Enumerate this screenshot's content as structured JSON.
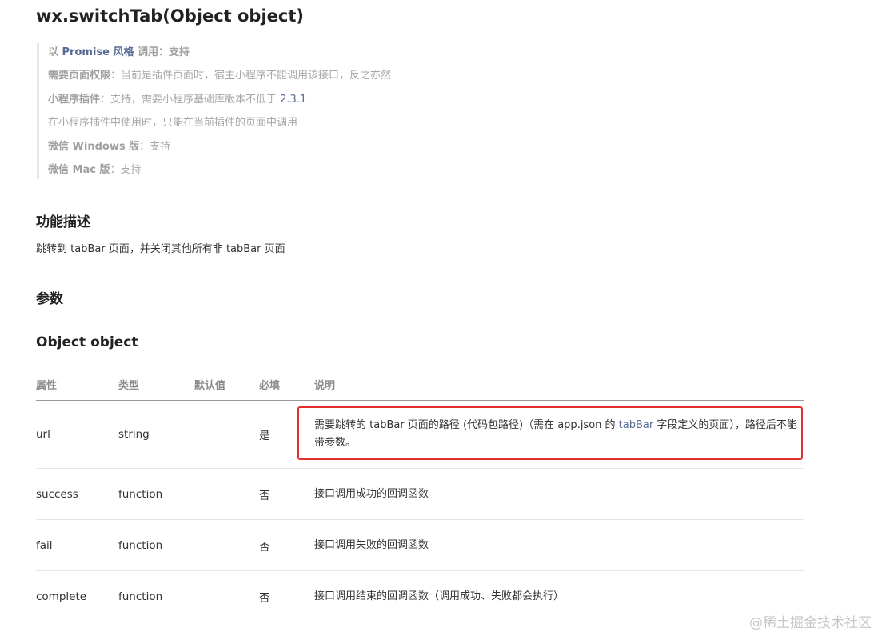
{
  "title": "wx.switchTab(Object object)",
  "notes": [
    {
      "prefix": "以 ",
      "link": "Promise 风格",
      "suffix": " 调用：支持"
    },
    {
      "label": "需要页面权限",
      "text": "：当前是插件页面时，宿主小程序不能调用该接口，反之亦然"
    },
    {
      "label": "小程序插件",
      "text": "：支持，需要小程序基础库版本不低于 ",
      "version": "2.3.1"
    },
    {
      "text": "在小程序插件中使用时，只能在当前插件的页面中调用"
    },
    {
      "label": "微信 Windows 版",
      "text": "：支持"
    },
    {
      "label": "微信 Mac 版",
      "text": "：支持"
    }
  ],
  "section_desc": {
    "heading": "功能描述",
    "text": "跳转到 tabBar 页面，并关闭其他所有非 tabBar 页面"
  },
  "section_params": {
    "heading": "参数"
  },
  "section_object": {
    "heading": "Object object"
  },
  "table": {
    "headers": [
      "属性",
      "类型",
      "默认值",
      "必填",
      "说明"
    ],
    "rows": [
      {
        "name": "url",
        "type": "string",
        "default": "",
        "required": "是",
        "desc_before": "需要跳转的 tabBar 页面的路径 (代码包路径)（需在 app.json 的 ",
        "desc_link": "tabBar",
        "desc_after": " 字段定义的页面），路径后不能带参数。"
      },
      {
        "name": "success",
        "type": "function",
        "default": "",
        "required": "否",
        "desc": "接口调用成功的回调函数"
      },
      {
        "name": "fail",
        "type": "function",
        "default": "",
        "required": "否",
        "desc": "接口调用失败的回调函数"
      },
      {
        "name": "complete",
        "type": "function",
        "default": "",
        "required": "否",
        "desc": "接口调用结束的回调函数（调用成功、失败都会执行）"
      }
    ]
  },
  "watermark": "@稀土掘金技术社区",
  "colors": {
    "link": "#576b95",
    "highlight_border": "#e03030"
  }
}
